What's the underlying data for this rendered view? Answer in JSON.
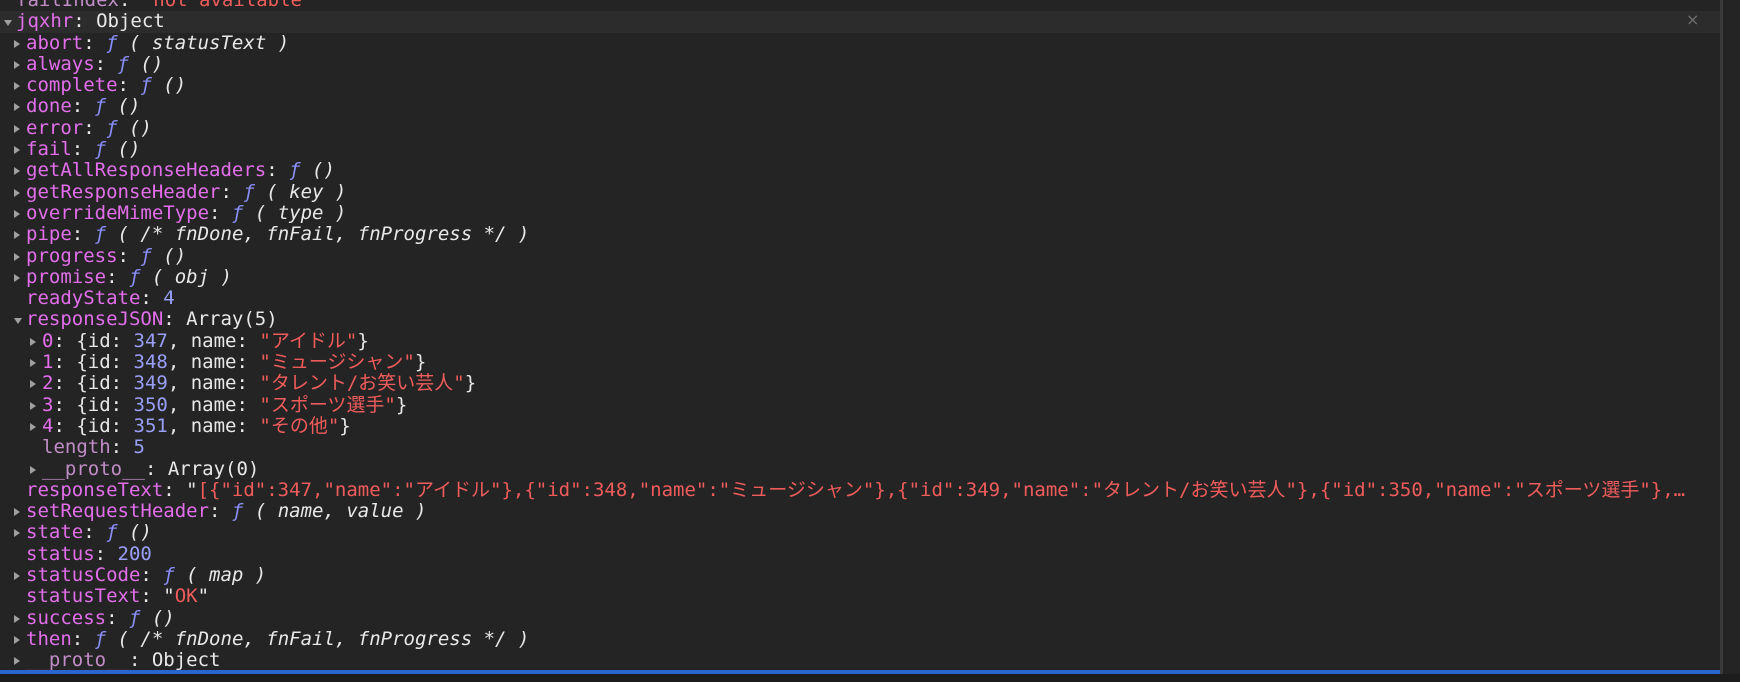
{
  "rows": [
    {
      "indent": 18,
      "arrow": "none",
      "parts": [
        {
          "c": "key dim",
          "t": "failIndex"
        },
        {
          "c": "plain",
          "t": ": "
        },
        {
          "c": "str",
          "t": "\"not available\""
        }
      ]
    },
    {
      "indent": 18,
      "arrow": "down",
      "top": true,
      "parts": [
        {
          "c": "key",
          "t": "jqxhr"
        },
        {
          "c": "plain",
          "t": ": Object"
        }
      ]
    },
    {
      "indent": 28,
      "arrow": "right",
      "parts": [
        {
          "c": "key",
          "t": "abort"
        },
        {
          "c": "plain",
          "t": ": "
        },
        {
          "c": "fn",
          "t": "ƒ"
        },
        {
          "c": "sig",
          "t": " ( statusText )"
        }
      ]
    },
    {
      "indent": 28,
      "arrow": "right",
      "parts": [
        {
          "c": "key",
          "t": "always"
        },
        {
          "c": "plain",
          "t": ": "
        },
        {
          "c": "fn",
          "t": "ƒ"
        },
        {
          "c": "sig",
          "t": " ()"
        }
      ]
    },
    {
      "indent": 28,
      "arrow": "right",
      "parts": [
        {
          "c": "key",
          "t": "complete"
        },
        {
          "c": "plain",
          "t": ": "
        },
        {
          "c": "fn",
          "t": "ƒ"
        },
        {
          "c": "sig",
          "t": " ()"
        }
      ]
    },
    {
      "indent": 28,
      "arrow": "right",
      "parts": [
        {
          "c": "key",
          "t": "done"
        },
        {
          "c": "plain",
          "t": ": "
        },
        {
          "c": "fn",
          "t": "ƒ"
        },
        {
          "c": "sig",
          "t": " ()"
        }
      ]
    },
    {
      "indent": 28,
      "arrow": "right",
      "parts": [
        {
          "c": "key",
          "t": "error"
        },
        {
          "c": "plain",
          "t": ": "
        },
        {
          "c": "fn",
          "t": "ƒ"
        },
        {
          "c": "sig",
          "t": " ()"
        }
      ]
    },
    {
      "indent": 28,
      "arrow": "right",
      "parts": [
        {
          "c": "key",
          "t": "fail"
        },
        {
          "c": "plain",
          "t": ": "
        },
        {
          "c": "fn",
          "t": "ƒ"
        },
        {
          "c": "sig",
          "t": " ()"
        }
      ]
    },
    {
      "indent": 28,
      "arrow": "right",
      "parts": [
        {
          "c": "key",
          "t": "getAllResponseHeaders"
        },
        {
          "c": "plain",
          "t": ": "
        },
        {
          "c": "fn",
          "t": "ƒ"
        },
        {
          "c": "sig",
          "t": " ()"
        }
      ]
    },
    {
      "indent": 28,
      "arrow": "right",
      "parts": [
        {
          "c": "key",
          "t": "getResponseHeader"
        },
        {
          "c": "plain",
          "t": ": "
        },
        {
          "c": "fn",
          "t": "ƒ"
        },
        {
          "c": "sig",
          "t": " ( key )"
        }
      ]
    },
    {
      "indent": 28,
      "arrow": "right",
      "parts": [
        {
          "c": "key",
          "t": "overrideMimeType"
        },
        {
          "c": "plain",
          "t": ": "
        },
        {
          "c": "fn",
          "t": "ƒ"
        },
        {
          "c": "sig",
          "t": " ( type )"
        }
      ]
    },
    {
      "indent": 28,
      "arrow": "right",
      "parts": [
        {
          "c": "key",
          "t": "pipe"
        },
        {
          "c": "plain",
          "t": ": "
        },
        {
          "c": "fn",
          "t": "ƒ"
        },
        {
          "c": "sig",
          "t": " ( /* fnDone, fnFail, fnProgress */ )"
        }
      ]
    },
    {
      "indent": 28,
      "arrow": "right",
      "parts": [
        {
          "c": "key",
          "t": "progress"
        },
        {
          "c": "plain",
          "t": ": "
        },
        {
          "c": "fn",
          "t": "ƒ"
        },
        {
          "c": "sig",
          "t": " ()"
        }
      ]
    },
    {
      "indent": 28,
      "arrow": "right",
      "parts": [
        {
          "c": "key",
          "t": "promise"
        },
        {
          "c": "plain",
          "t": ": "
        },
        {
          "c": "fn",
          "t": "ƒ"
        },
        {
          "c": "sig",
          "t": " ( obj )"
        }
      ]
    },
    {
      "indent": 28,
      "arrow": "none",
      "parts": [
        {
          "c": "key",
          "t": "readyState"
        },
        {
          "c": "plain",
          "t": ": "
        },
        {
          "c": "num",
          "t": "4"
        }
      ]
    },
    {
      "indent": 28,
      "arrow": "down",
      "parts": [
        {
          "c": "key",
          "t": "responseJSON"
        },
        {
          "c": "plain",
          "t": ": Array(5)"
        }
      ]
    },
    {
      "indent": 44,
      "arrow": "right",
      "parts": [
        {
          "c": "key",
          "t": "0"
        },
        {
          "c": "plain",
          "t": ": {id: "
        },
        {
          "c": "num",
          "t": "347"
        },
        {
          "c": "plain",
          "t": ", name: "
        },
        {
          "c": "str",
          "t": "\"アイドル\""
        },
        {
          "c": "plain",
          "t": "}"
        }
      ]
    },
    {
      "indent": 44,
      "arrow": "right",
      "parts": [
        {
          "c": "key",
          "t": "1"
        },
        {
          "c": "plain",
          "t": ": {id: "
        },
        {
          "c": "num",
          "t": "348"
        },
        {
          "c": "plain",
          "t": ", name: "
        },
        {
          "c": "str",
          "t": "\"ミュージシャン\""
        },
        {
          "c": "plain",
          "t": "}"
        }
      ]
    },
    {
      "indent": 44,
      "arrow": "right",
      "parts": [
        {
          "c": "key",
          "t": "2"
        },
        {
          "c": "plain",
          "t": ": {id: "
        },
        {
          "c": "num",
          "t": "349"
        },
        {
          "c": "plain",
          "t": ", name: "
        },
        {
          "c": "str",
          "t": "\"タレント/お笑い芸人\""
        },
        {
          "c": "plain",
          "t": "}"
        }
      ]
    },
    {
      "indent": 44,
      "arrow": "right",
      "parts": [
        {
          "c": "key",
          "t": "3"
        },
        {
          "c": "plain",
          "t": ": {id: "
        },
        {
          "c": "num",
          "t": "350"
        },
        {
          "c": "plain",
          "t": ", name: "
        },
        {
          "c": "str",
          "t": "\"スポーツ選手\""
        },
        {
          "c": "plain",
          "t": "}"
        }
      ]
    },
    {
      "indent": 44,
      "arrow": "right",
      "parts": [
        {
          "c": "key",
          "t": "4"
        },
        {
          "c": "plain",
          "t": ": {id: "
        },
        {
          "c": "num",
          "t": "351"
        },
        {
          "c": "plain",
          "t": ", name: "
        },
        {
          "c": "str",
          "t": "\"その他\""
        },
        {
          "c": "plain",
          "t": "}"
        }
      ]
    },
    {
      "indent": 44,
      "arrow": "none",
      "parts": [
        {
          "c": "key dim",
          "t": "length"
        },
        {
          "c": "plain",
          "t": ": "
        },
        {
          "c": "num",
          "t": "5"
        }
      ]
    },
    {
      "indent": 44,
      "arrow": "right",
      "parts": [
        {
          "c": "key dim",
          "t": "__proto__"
        },
        {
          "c": "plain",
          "t": ": Array(0)"
        }
      ]
    },
    {
      "indent": 28,
      "arrow": "none",
      "parts": [
        {
          "c": "key",
          "t": "responseText"
        },
        {
          "c": "plain",
          "t": ": \""
        },
        {
          "c": "str",
          "t": "[{\"id\":347,\"name\":\"アイドル\"},{\"id\":348,\"name\":\"ミュージシャン\"},{\"id\":349,\"name\":\"タレント/お笑い芸人\"},{\"id\":350,\"name\":\"スポーツ選手\"},…"
        }
      ]
    },
    {
      "indent": 28,
      "arrow": "right",
      "parts": [
        {
          "c": "key",
          "t": "setRequestHeader"
        },
        {
          "c": "plain",
          "t": ": "
        },
        {
          "c": "fn",
          "t": "ƒ"
        },
        {
          "c": "sig",
          "t": " ( name, value )"
        }
      ]
    },
    {
      "indent": 28,
      "arrow": "right",
      "parts": [
        {
          "c": "key",
          "t": "state"
        },
        {
          "c": "plain",
          "t": ": "
        },
        {
          "c": "fn",
          "t": "ƒ"
        },
        {
          "c": "sig",
          "t": " ()"
        }
      ]
    },
    {
      "indent": 28,
      "arrow": "none",
      "parts": [
        {
          "c": "key",
          "t": "status"
        },
        {
          "c": "plain",
          "t": ": "
        },
        {
          "c": "num",
          "t": "200"
        }
      ]
    },
    {
      "indent": 28,
      "arrow": "right",
      "parts": [
        {
          "c": "key",
          "t": "statusCode"
        },
        {
          "c": "plain",
          "t": ": "
        },
        {
          "c": "fn",
          "t": "ƒ"
        },
        {
          "c": "sig",
          "t": " ( map )"
        }
      ]
    },
    {
      "indent": 28,
      "arrow": "none",
      "parts": [
        {
          "c": "key",
          "t": "statusText"
        },
        {
          "c": "plain",
          "t": ": \""
        },
        {
          "c": "str",
          "t": "OK"
        },
        {
          "c": "plain",
          "t": "\""
        }
      ]
    },
    {
      "indent": 28,
      "arrow": "right",
      "parts": [
        {
          "c": "key",
          "t": "success"
        },
        {
          "c": "plain",
          "t": ": "
        },
        {
          "c": "fn",
          "t": "ƒ"
        },
        {
          "c": "sig",
          "t": " ()"
        }
      ]
    },
    {
      "indent": 28,
      "arrow": "right",
      "parts": [
        {
          "c": "key",
          "t": "then"
        },
        {
          "c": "plain",
          "t": ": "
        },
        {
          "c": "fn",
          "t": "ƒ"
        },
        {
          "c": "sig",
          "t": " ( /* fnDone, fnFail, fnProgress */ )"
        }
      ]
    },
    {
      "indent": 28,
      "arrow": "right",
      "parts": [
        {
          "c": "key dim",
          "t": "__proto__"
        },
        {
          "c": "plain",
          "t": ": Object"
        }
      ]
    }
  ],
  "close_glyph": "×"
}
